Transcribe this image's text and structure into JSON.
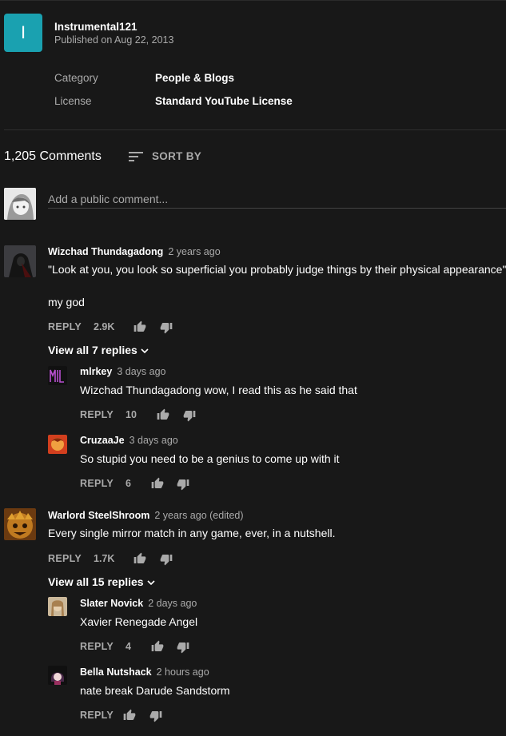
{
  "channel": {
    "avatar_letter": "I",
    "name": "Instrumental121",
    "published": "Published on Aug 22, 2013"
  },
  "meta": [
    {
      "key": "Category",
      "value": "People & Blogs"
    },
    {
      "key": "License",
      "value": "Standard YouTube License"
    }
  ],
  "comments_header": {
    "count": "1,205 Comments",
    "sort_label": "SORT BY"
  },
  "add_comment": {
    "placeholder": "Add a public comment..."
  },
  "reply_label": "REPLY",
  "threads": [
    {
      "author": "Wizchad Thundagadong",
      "time": "2 years ago",
      "text": "\"Look at you, you look so superficial you probably judge things by their physical appearance\"",
      "text2": "my god",
      "likes": "2.9K",
      "view_replies": "View all 7 replies",
      "replies": [
        {
          "author": "mlrkey",
          "time": "3 days ago",
          "text": "Wizchad Thundagadong wow, I read this as he said that",
          "likes": "10"
        },
        {
          "author": "CruzaaJe",
          "time": "3 days ago",
          "text": "So stupid you need to be a genius to come up with it",
          "likes": "6"
        }
      ]
    },
    {
      "author": "Warlord SteelShroom",
      "time": "2 years ago (edited)",
      "text": "Every single mirror match in any game, ever, in a nutshell.",
      "likes": "1.7K",
      "view_replies": "View all 15 replies",
      "replies": [
        {
          "author": "Slater Novick",
          "time": "2 days ago",
          "text": "Xavier Renegade Angel",
          "likes": "4"
        },
        {
          "author": "Bella Nutshack",
          "time": "2 hours ago",
          "text": "nate break Darude Sandstorm",
          "likes": ""
        }
      ]
    }
  ],
  "colors": {
    "background": "#181818",
    "channel_avatar": "#1aa1b0",
    "muted_text": "#aaaaaa"
  }
}
